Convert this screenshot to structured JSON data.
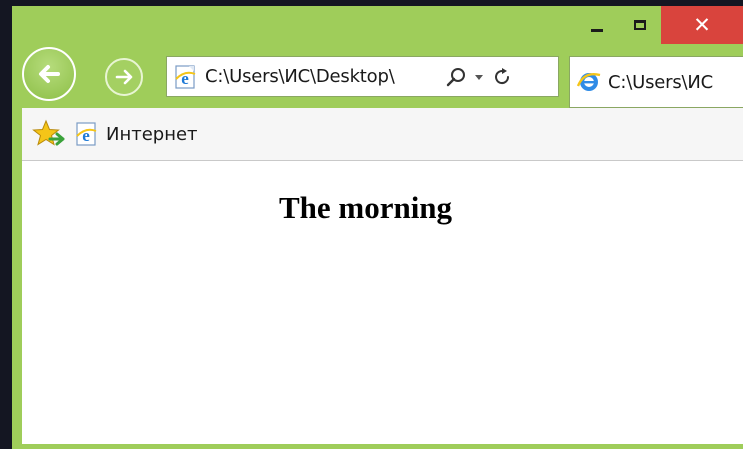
{
  "window": {
    "caption_buttons": {
      "minimize": "minimize-icon",
      "maximize": "maximize-icon",
      "close": "✕"
    },
    "accent_color": "#9fcd5a",
    "close_color": "#d9443d"
  },
  "navigation": {
    "back_icon": "back-arrow-icon",
    "forward_icon": "forward-arrow-icon",
    "address": "C:\\Users\\ИС\\Desktop\\",
    "tools": [
      "search-icon",
      "dropdown-icon",
      "refresh-icon"
    ]
  },
  "tab": {
    "label": "C:\\Users\\ИС"
  },
  "favorites_bar": {
    "items": [
      {
        "icon": "add-favorites-star-icon"
      },
      {
        "icon": "ie-icon",
        "label": "Интернет"
      }
    ]
  },
  "page": {
    "heading": "The morning"
  }
}
